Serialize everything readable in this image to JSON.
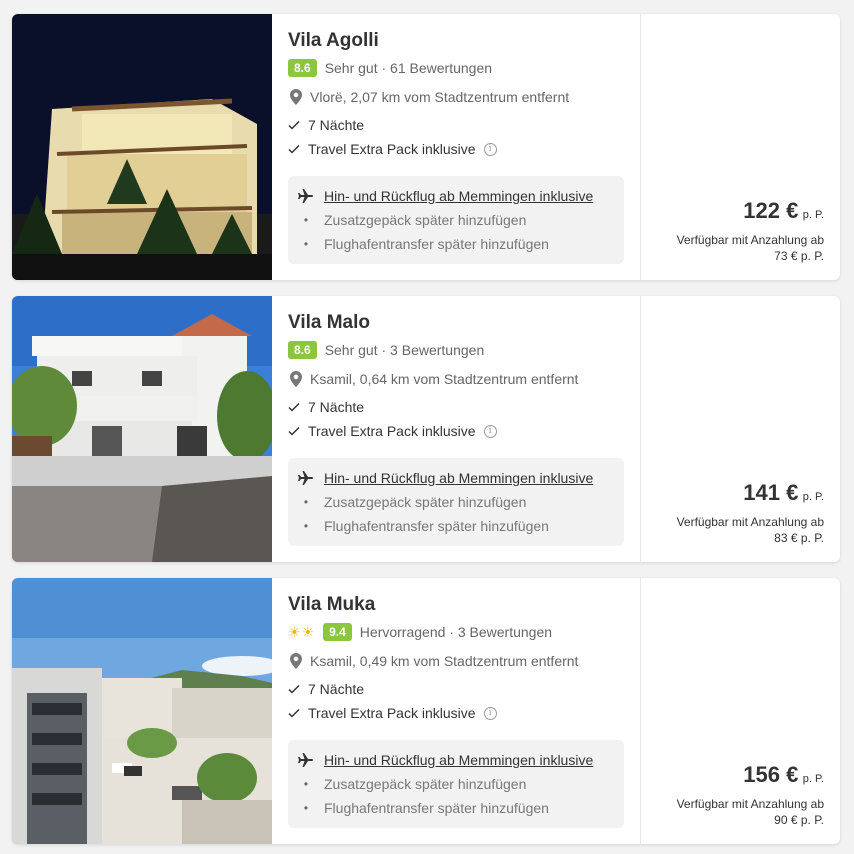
{
  "hotels": [
    {
      "name": "Vila Agolli",
      "suns": "",
      "score": "8.6",
      "rating_text": "Sehr gut · 61 Bewertungen",
      "location": "Vlorë, 2,07 km vom Stadtzentrum entfernt",
      "nights": "7 Nächte",
      "extra_pack": "Travel Extra Pack inklusive",
      "flight": "Hin- und Rückflug ab Memmingen inklusive",
      "baggage": "Zusatzgepäck später hinzufügen",
      "transfer": "Flughafentransfer später hinzufügen",
      "price": "122 €",
      "per_person": "p. P.",
      "deposit_line1": "Verfügbar mit Anzahlung ab",
      "deposit_line2": "73 € p. P."
    },
    {
      "name": "Vila Malo",
      "suns": "",
      "score": "8.6",
      "rating_text": "Sehr gut · 3 Bewertungen",
      "location": "Ksamil, 0,64 km vom Stadtzentrum entfernt",
      "nights": "7 Nächte",
      "extra_pack": "Travel Extra Pack inklusive",
      "flight": "Hin- und Rückflug ab Memmingen inklusive",
      "baggage": "Zusatzgepäck später hinzufügen",
      "transfer": "Flughafentransfer später hinzufügen",
      "price": "141 €",
      "per_person": "p. P.",
      "deposit_line1": "Verfügbar mit Anzahlung ab",
      "deposit_line2": "83 € p. P."
    },
    {
      "name": "Vila Muka",
      "suns": "☀☀",
      "score": "9.4",
      "rating_text": "Hervorragend · 3 Bewertungen",
      "location": "Ksamil, 0,49 km vom Stadtzentrum entfernt",
      "nights": "7 Nächte",
      "extra_pack": "Travel Extra Pack inklusive",
      "flight": "Hin- und Rückflug ab Memmingen inklusive",
      "baggage": "Zusatzgepäck später hinzufügen",
      "transfer": "Flughafentransfer später hinzufügen",
      "price": "156 €",
      "per_person": "p. P.",
      "deposit_line1": "Verfügbar mit Anzahlung ab",
      "deposit_line2": "90 € p. P."
    }
  ],
  "icons": {
    "location": "map-pin-icon",
    "check": "check-icon",
    "info": "info-icon",
    "flight": "airplane-icon",
    "rating_sun": "sun-icon"
  },
  "colors": {
    "score_badge": "#8cc63f",
    "sun": "#f5b400",
    "box_bg": "#f2f2f2"
  }
}
